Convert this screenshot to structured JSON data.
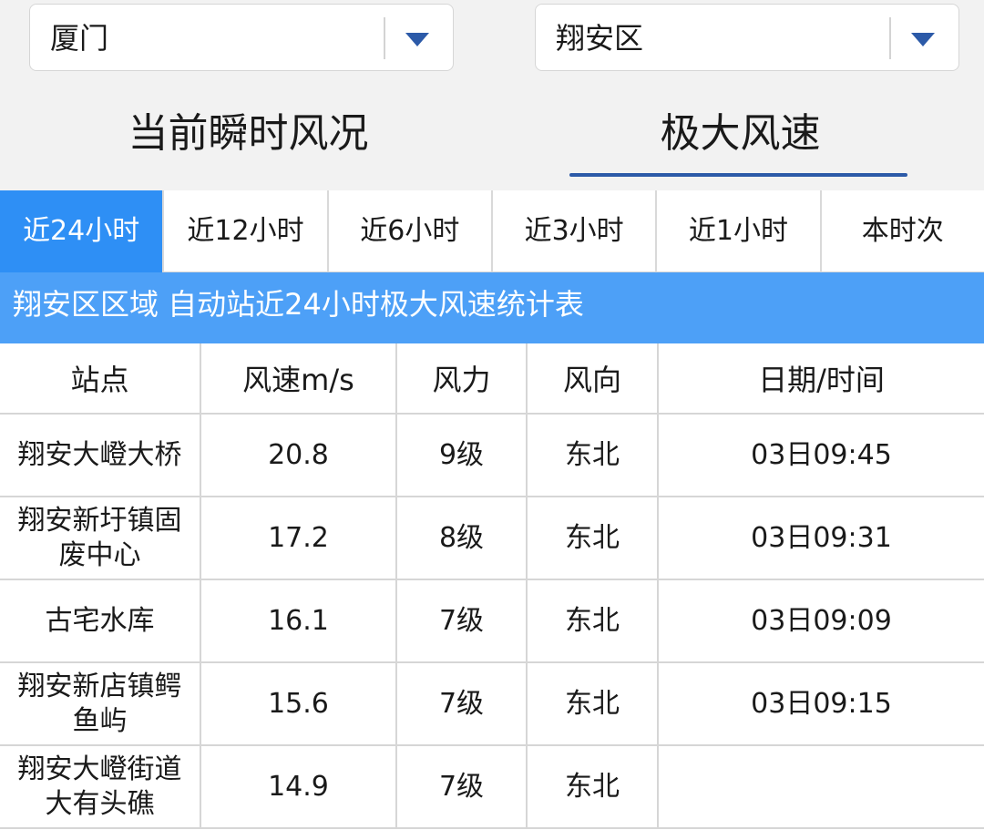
{
  "selectors": {
    "city": "厦门",
    "district": "翔安区"
  },
  "mode_tabs": [
    "当前瞬时风况",
    "极大风速"
  ],
  "range_tabs": [
    "近24小时",
    "近12小时",
    "近6小时",
    "近3小时",
    "近1小时",
    "本时次"
  ],
  "banner": "翔安区区域 自动站近24小时极大风速统计表",
  "table": {
    "headers": [
      "站点",
      "风速m/s",
      "风力",
      "风向",
      "日期/时间"
    ],
    "rows": [
      [
        "翔安大嶝大桥",
        "20.8",
        "9级",
        "东北",
        "03日09:45"
      ],
      [
        "翔安新圩镇固废中心",
        "17.2",
        "8级",
        "东北",
        "03日09:31"
      ],
      [
        "古宅水库",
        "16.1",
        "7级",
        "东北",
        "03日09:09"
      ],
      [
        "翔安新店镇鳄鱼屿",
        "15.6",
        "7级",
        "东北",
        "03日09:15"
      ],
      [
        "翔安大嶝街道大有头礁",
        "14.9",
        "7级",
        "东北",
        ""
      ]
    ]
  },
  "colors": {
    "active_tab": "#2e8ff5",
    "banner": "#4da0f7",
    "accent": "#2c5aa8"
  }
}
